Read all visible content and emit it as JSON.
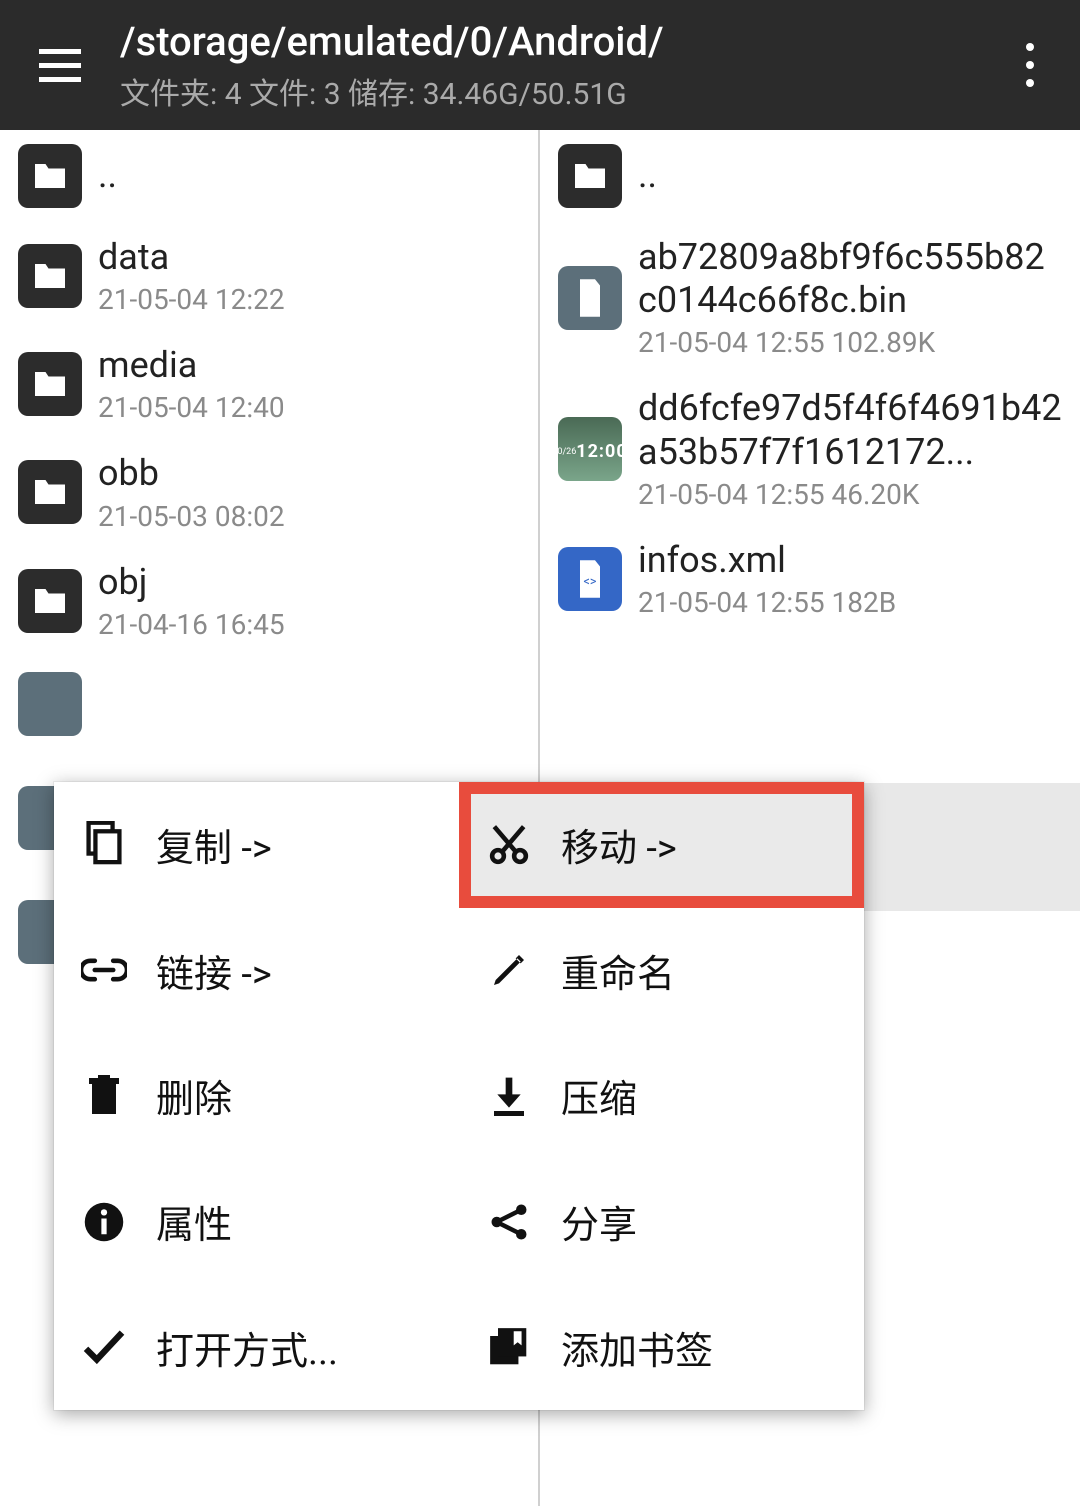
{
  "header": {
    "path": "/storage/emulated/0/Android/",
    "stats": "文件夹: 4  文件: 3  储存: 34.46G/50.51G"
  },
  "left_pane": {
    "up": "..",
    "items": [
      {
        "name": "data",
        "sub": "21-05-04 12:22"
      },
      {
        "name": "media",
        "sub": "21-05-04 12:40"
      },
      {
        "name": "obb",
        "sub": "21-05-03 08:02"
      },
      {
        "name": "obj",
        "sub": "21-04-16 16:45"
      }
    ]
  },
  "right_pane": {
    "up": "..",
    "items": [
      {
        "name": "ab72809a8bf9f6c555b82c0144c66f8c.bin",
        "sub": "21-05-04 12:55  102.89K",
        "kind": "file-gray"
      },
      {
        "name": "dd6fcfe97d5f4f6f4691b42a53b57f7f1612172...",
        "sub": "21-05-04 12:55  46.20K",
        "kind": "thumb",
        "thumb_time": "12:00"
      },
      {
        "name": "infos.xml",
        "sub": "21-05-04 12:55  182B",
        "kind": "file-blue"
      }
    ]
  },
  "menu": {
    "copy": "复制 ->",
    "move": "移动 ->",
    "link": "链接 ->",
    "rename": "重命名",
    "delete": "删除",
    "compress": "压缩",
    "props": "属性",
    "share": "分享",
    "openwith": "打开方式...",
    "bookmark": "添加书签"
  }
}
